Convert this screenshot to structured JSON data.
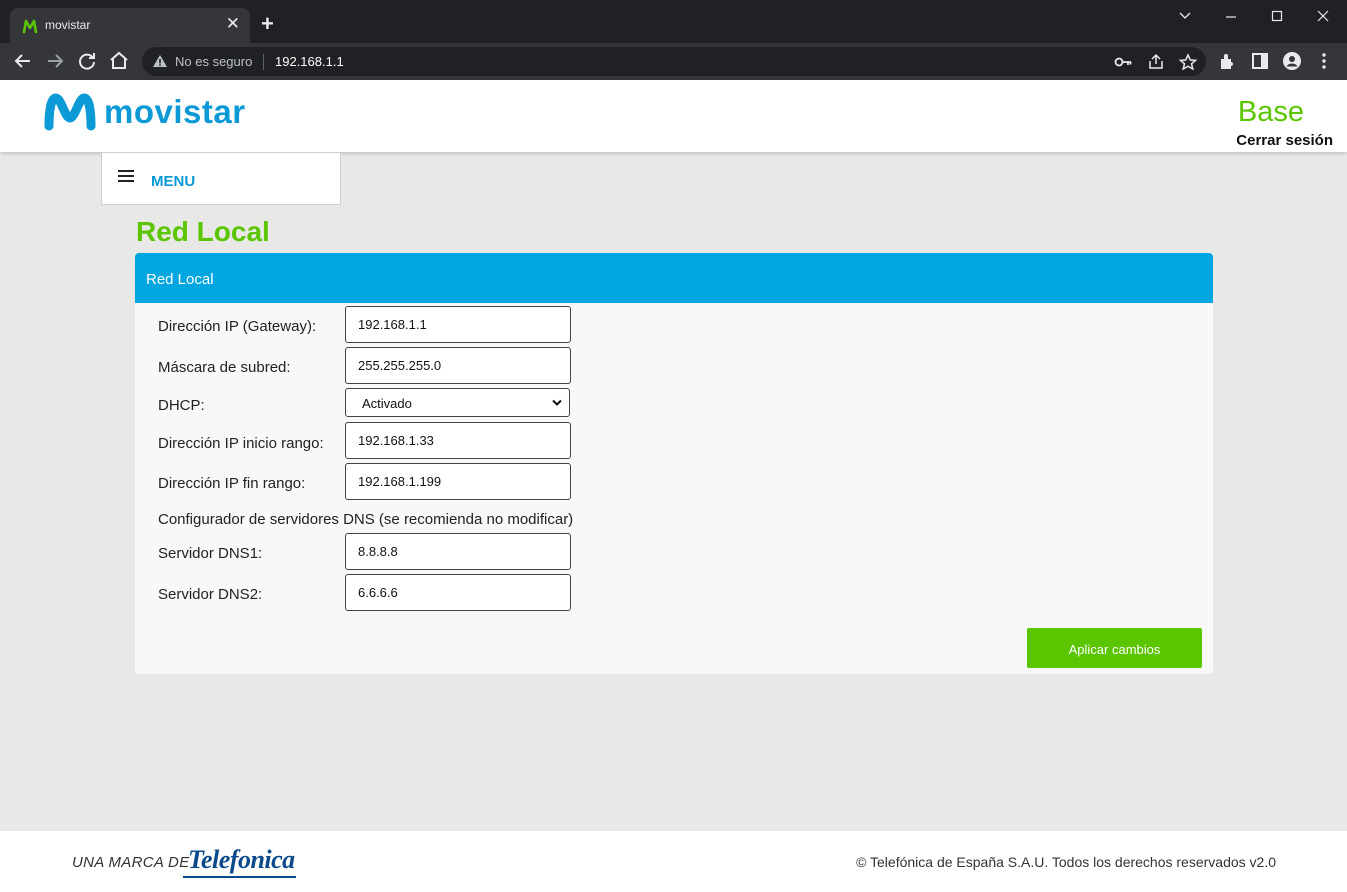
{
  "browser": {
    "tab_title": "movistar",
    "tab_close": "✕",
    "new_tab": "+",
    "insecure_label": "No es seguro",
    "url": "192.168.1.1",
    "icons": [
      "back-icon",
      "forward-icon",
      "reload-icon",
      "home-icon",
      "warning-icon",
      "key-icon",
      "share-icon",
      "star-icon",
      "extensions-icon",
      "sidepanel-icon",
      "profile-icon",
      "kebab-menu-icon"
    ]
  },
  "header": {
    "logo_text": "movistar",
    "title": "Base",
    "logout": "Cerrar sesión"
  },
  "menu": {
    "label": "MENU"
  },
  "page": {
    "section_title": "Red Local",
    "card_title": "Red Local"
  },
  "form": {
    "gateway_label": "Dirección IP (Gateway):",
    "gateway_value": "192.168.1.1",
    "mask_label": "Máscara de subred:",
    "mask_value": "255.255.255.0",
    "dhcp_label": "DHCP:",
    "dhcp_value": "Activado",
    "range_start_label": "Dirección IP inicio rango:",
    "range_start_value": "192.168.1.33",
    "range_end_label": "Dirección IP fin rango:",
    "range_end_value": "192.168.1.199",
    "dns_heading": "Configurador de servidores DNS (se recomienda no modificar)",
    "dns1_label": "Servidor DNS1:",
    "dns1_value": "8.8.8.8",
    "dns2_label": "Servidor DNS2:",
    "dns2_value": "6.6.6.6",
    "apply_label": "Aplicar cambios"
  },
  "footer": {
    "brand_prefix": "UNA MARCA DE",
    "brand_name": "Telefonica",
    "copyright": "© Telefónica de España S.A.U. Todos los derechos reservados v2.0"
  },
  "colors": {
    "movistar_blue": "#0b9ad6",
    "accent_green": "#5bc500",
    "card_header_blue": "#00a6e0",
    "page_background": "#e8e8e6"
  }
}
